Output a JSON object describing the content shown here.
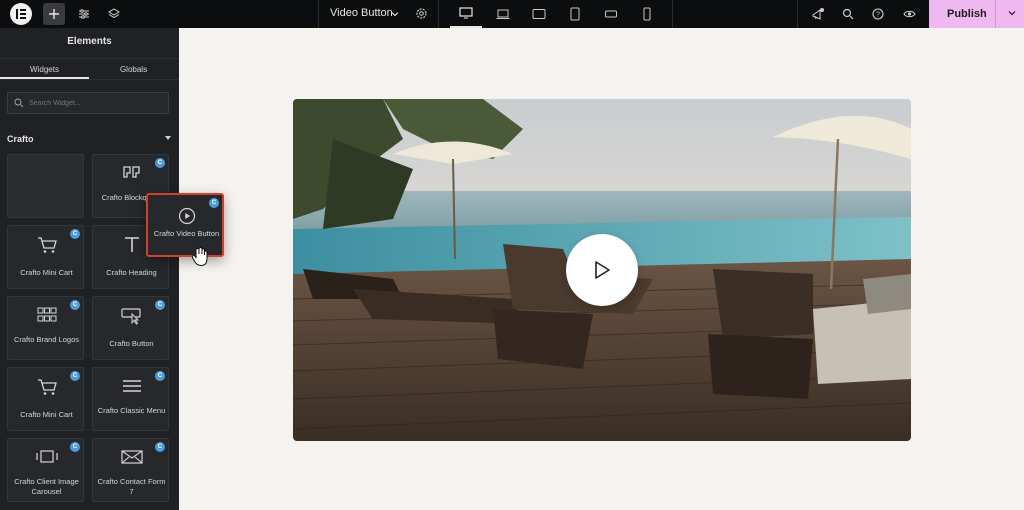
{
  "topbar": {
    "page_title": "Video Button",
    "publish_label": "Publish",
    "icons": [
      "elementor-logo-icon",
      "plus-icon",
      "sliders-icon",
      "layers-icon",
      "chevron-down-icon",
      "gear-icon",
      "desktop-icon",
      "laptop-icon",
      "tablet-landscape-icon",
      "tablet-icon",
      "mobile-landscape-icon",
      "mobile-icon",
      "notifications-icon",
      "search-icon",
      "help-icon",
      "eye-icon"
    ]
  },
  "panel": {
    "title": "Elements",
    "tabs": [
      "Widgets",
      "Globals"
    ],
    "search_placeholder": "Search Widget...",
    "section_title": "Crafto",
    "badge": "C",
    "tiles": [
      {
        "label": "",
        "icon": "blank"
      },
      {
        "label": "Crafto Blockquote",
        "icon": "quote-icon"
      },
      {
        "label": "Crafto Mini Cart",
        "icon": "cart-icon"
      },
      {
        "label": "Crafto Heading",
        "icon": "heading-icon"
      },
      {
        "label": "Crafto Brand Logos",
        "icon": "grid-icon"
      },
      {
        "label": "Crafto Button",
        "icon": "button-icon"
      },
      {
        "label": "Crafto Mini Cart",
        "icon": "cart-icon"
      },
      {
        "label": "Crafto Classic Menu",
        "icon": "menu-icon"
      },
      {
        "label": "Crafto Client Image Carousel",
        "icon": "carousel-icon"
      },
      {
        "label": "Crafto Contact Form 7",
        "icon": "envelope-icon"
      }
    ],
    "dragging_tile": {
      "label": "Crafto Video Button",
      "icon": "play-circle-icon"
    }
  },
  "canvas": {
    "video": {
      "play_icon": "play-icon"
    }
  },
  "colors": {
    "accent": "#f0b8f0",
    "badge": "#4e9bd9",
    "drag_border": "#d0402a"
  }
}
